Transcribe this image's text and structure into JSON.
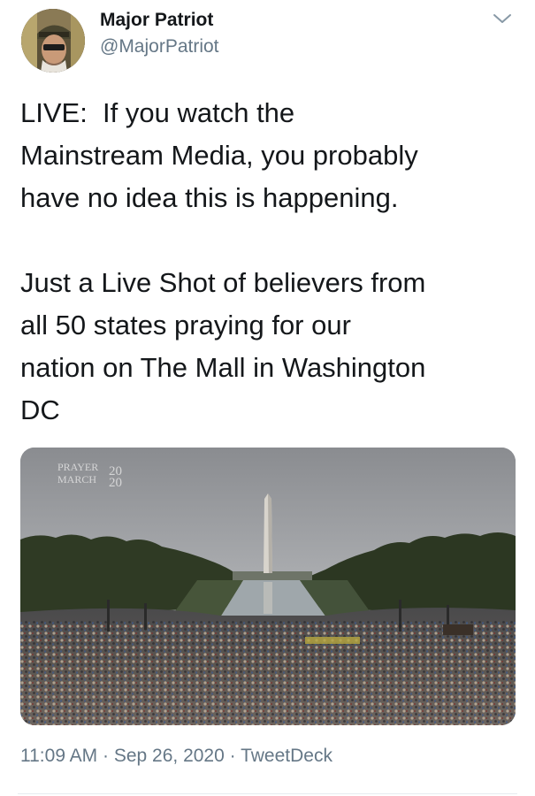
{
  "author": {
    "name": "Major Patriot",
    "handle": "@MajorPatriot",
    "avatar_icon": "soldier-portrait-icon"
  },
  "menu_icon": "chevron-down-icon",
  "tweet": {
    "text": "LIVE:  If you watch the\nMainstream Media, you probably\nhave no idea this is happening.\n\nJust a Live Shot of believers from\nall 50 states praying for our\nnation on The Mall in Washington\nDC"
  },
  "media": {
    "watermark_line1": "PRAYER",
    "watermark_line2": "MARCH",
    "watermark_year_top": "20",
    "watermark_year_bottom": "20"
  },
  "meta": {
    "time": "11:09 AM",
    "separator": " · ",
    "date": "Sep 26, 2020",
    "source": "TweetDeck"
  },
  "colors": {
    "text_primary": "#14171a",
    "text_secondary": "#657786",
    "divider": "#e6ecf0"
  }
}
